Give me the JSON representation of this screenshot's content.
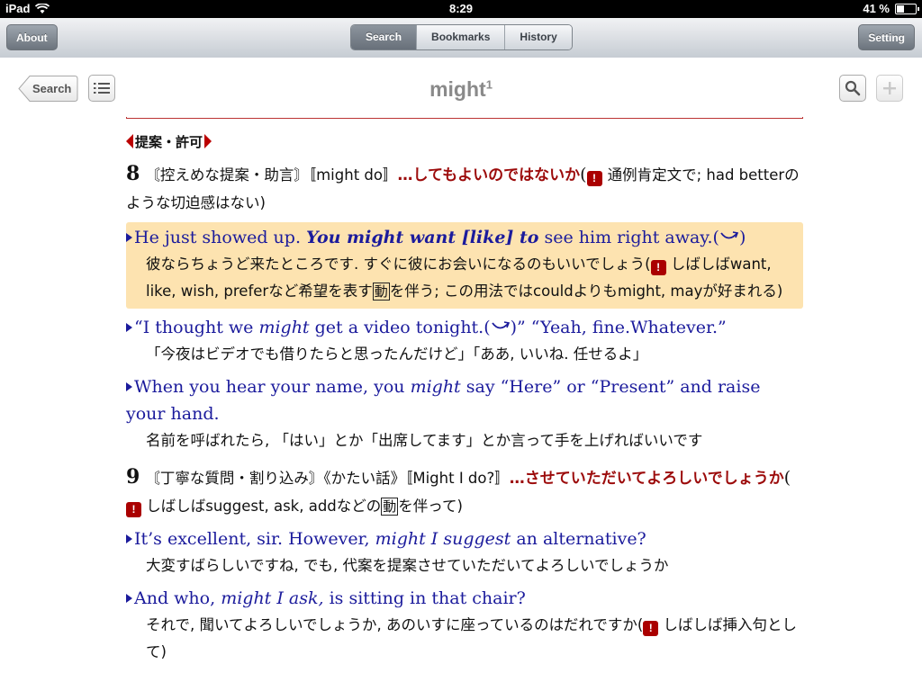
{
  "status": {
    "device": "iPad",
    "time": "8:29",
    "battery": "41 %",
    "battery_level": 0.41
  },
  "toolbar": {
    "about": "About",
    "tabs": [
      {
        "label": "Search"
      },
      {
        "label": "Bookmarks"
      },
      {
        "label": "History"
      }
    ],
    "setting": "Setting"
  },
  "nav": {
    "back": "Search",
    "title": "might",
    "title_sup": "1"
  },
  "content": {
    "section": "提案・許可",
    "def8": {
      "num": "8",
      "labels": "〘控えめな提案・助言〙〚might do〛",
      "meaning": "…してもよいのではないか",
      "note_open": "(",
      "note": "通例肯定文で; had betterのような切迫感はない)"
    },
    "ex1": {
      "en_pre": "He just showed up. ",
      "en_bi": "You might want [like] to",
      "en_post": " see him right away.(",
      "en_close": ")",
      "tr_pre": "彼ならちょうど来たところです. すぐに彼にお会いになるのもいいでしょう(",
      "tr_mid": " しばしばwant, like, wish, preferなど希望を表す",
      "box": "動",
      "tr_post": "を伴う; この用法ではcouldよりもmight, mayが好まれる)"
    },
    "ex2": {
      "en_pre": "“I thought we ",
      "en_i": "might",
      "en_post": " get a video tonight.(",
      "en_close": ")” “Yeah, fine.Whatever.”",
      "tr": "「今夜はビデオでも借りたらと思ったんだけど」「ああ, いいね. 任せるよ」"
    },
    "ex3": {
      "en_pre": "When you hear your name, you ",
      "en_i": "might",
      "en_post": " say “Here” or “Present” and raise your hand.",
      "tr": "名前を呼ばれたら, 「はい」とか「出席してます」とか言って手を上げればいいです"
    },
    "def9": {
      "num": "9",
      "labels": "〘丁寧な質問・割り込み〙《かたい話》〚Might I do?〛",
      "meaning": "…させていただいてよろしいでしょうか",
      "note_open": "(",
      "note_pre": " しばしばsuggest, ask, addなどの",
      "box": "動",
      "note_post": "を伴って)"
    },
    "ex4": {
      "en_pre": "It’s excellent, sir. However, ",
      "en_i": "might I suggest",
      "en_post": " an alternative?",
      "tr": "大変すばらしいですね, でも, 代案を提案させていただいてよろしいでしょうか"
    },
    "ex5": {
      "en_pre": "And who, ",
      "en_i": "might I ask,",
      "en_post": " is sitting in that chair?",
      "tr_pre": "それで, 聞いてよろしいでしょうか, あのいすに座っているのはだれですか(",
      "tr_post": " しばしば挿入句として)"
    }
  }
}
